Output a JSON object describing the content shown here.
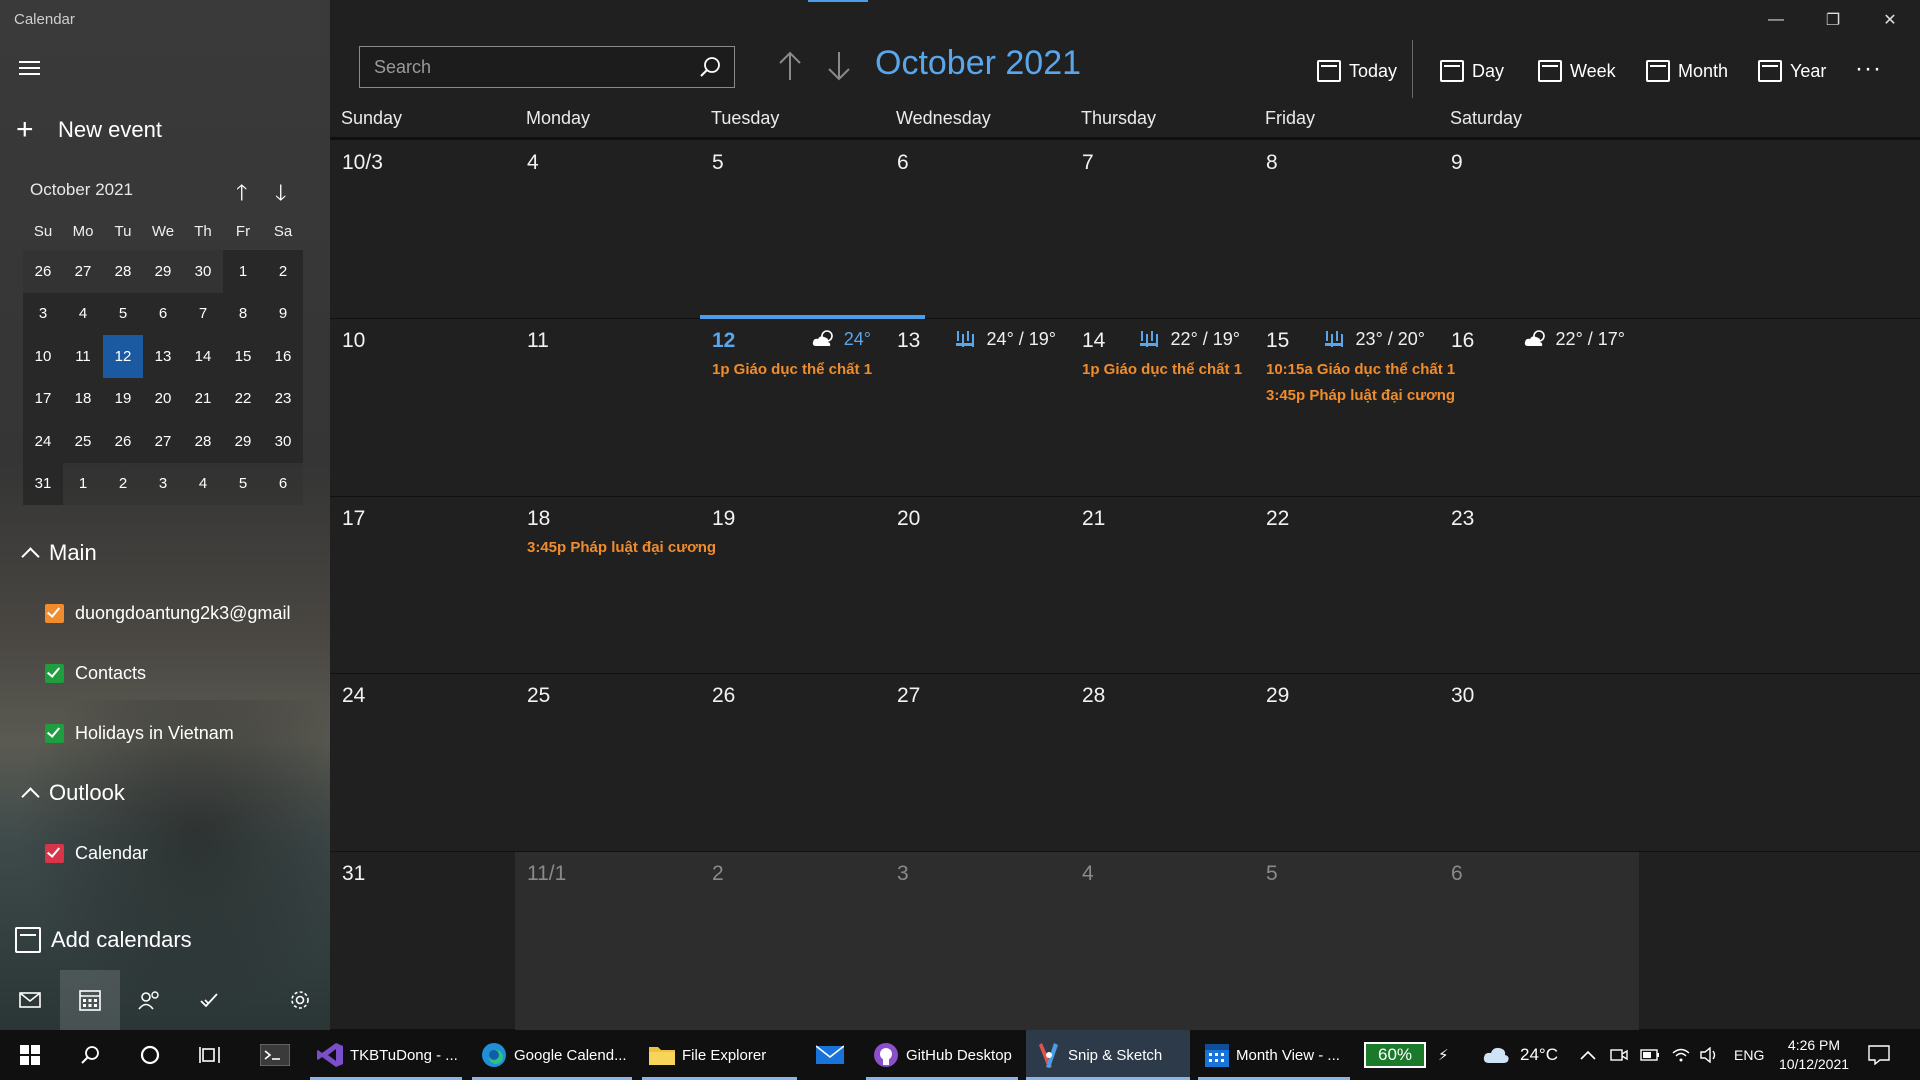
{
  "app": {
    "title": "Calendar"
  },
  "sidebar": {
    "new_event": "New event",
    "mini_month": "October 2021",
    "dow": [
      "Su",
      "Mo",
      "Tu",
      "We",
      "Th",
      "Fr",
      "Sa"
    ],
    "weeks": [
      [
        "26",
        "27",
        "28",
        "29",
        "30",
        "1",
        "2"
      ],
      [
        "3",
        "4",
        "5",
        "6",
        "7",
        "8",
        "9"
      ],
      [
        "10",
        "11",
        "12",
        "13",
        "14",
        "15",
        "16"
      ],
      [
        "17",
        "18",
        "19",
        "20",
        "21",
        "22",
        "23"
      ],
      [
        "24",
        "25",
        "26",
        "27",
        "28",
        "29",
        "30"
      ],
      [
        "31",
        "1",
        "2",
        "3",
        "4",
        "5",
        "6"
      ]
    ],
    "groups": [
      {
        "label": "Main",
        "items": [
          {
            "label": "duongdoantung2k3@gmail",
            "color": "#f08c2c"
          },
          {
            "label": "Contacts",
            "color": "#1f9e3f"
          },
          {
            "label": "Holidays in Vietnam",
            "color": "#1f9e3f"
          }
        ]
      },
      {
        "label": "Outlook",
        "items": [
          {
            "label": "Calendar",
            "color": "#d9344a"
          }
        ]
      }
    ],
    "add_calendars": "Add calendars"
  },
  "toolbar": {
    "search_placeholder": "Search",
    "month_title": "October 2021",
    "today": "Today",
    "day": "Day",
    "week": "Week",
    "month": "Month",
    "year": "Year",
    "more": "···"
  },
  "days_of_week": [
    "Sunday",
    "Monday",
    "Tuesday",
    "Wednesday",
    "Thursday",
    "Friday",
    "Saturday"
  ],
  "grid": [
    [
      {
        "n": "10/3"
      },
      {
        "n": "4"
      },
      {
        "n": "5"
      },
      {
        "n": "6"
      },
      {
        "n": "7"
      },
      {
        "n": "8"
      },
      {
        "n": "9"
      }
    ],
    [
      {
        "n": "10"
      },
      {
        "n": "11"
      },
      {
        "n": "12",
        "today": true,
        "weather": "24°",
        "wicon": "partly-cloudy",
        "events": [
          "1p Giáo dục thể chất 1"
        ]
      },
      {
        "n": "13",
        "weather": "24° / 19°",
        "wicon": "rain"
      },
      {
        "n": "14",
        "weather": "22° / 19°",
        "wicon": "rain",
        "events": [
          "1p Giáo dục thể chất 1"
        ]
      },
      {
        "n": "15",
        "weather": "23° / 20°",
        "wicon": "rain",
        "events": [
          "10:15a Giáo dục thể chất 1",
          "3:45p Pháp luật đại cương"
        ]
      },
      {
        "n": "16",
        "weather": "22° / 17°",
        "wicon": "partly-cloudy"
      }
    ],
    [
      {
        "n": "17"
      },
      {
        "n": "18",
        "events": [
          "3:45p Pháp luật đại cương"
        ]
      },
      {
        "n": "19"
      },
      {
        "n": "20"
      },
      {
        "n": "21"
      },
      {
        "n": "22"
      },
      {
        "n": "23"
      }
    ],
    [
      {
        "n": "24"
      },
      {
        "n": "25"
      },
      {
        "n": "26"
      },
      {
        "n": "27"
      },
      {
        "n": "28"
      },
      {
        "n": "29"
      },
      {
        "n": "30"
      }
    ],
    [
      {
        "n": "31"
      },
      {
        "n": "11/1",
        "other": true
      },
      {
        "n": "2",
        "other": true
      },
      {
        "n": "3",
        "other": true
      },
      {
        "n": "4",
        "other": true
      },
      {
        "n": "5",
        "other": true
      },
      {
        "n": "6",
        "other": true
      }
    ]
  ],
  "taskbar": {
    "apps": [
      {
        "label": "TKBTuDong - ...",
        "icon": "visual-studio-icon"
      },
      {
        "label": "Google Calend...",
        "icon": "edge-icon"
      },
      {
        "label": "File Explorer",
        "icon": "folder-icon"
      },
      {
        "label": "",
        "icon": "mail-icon"
      },
      {
        "label": "GitHub Desktop",
        "icon": "github-icon"
      },
      {
        "label": "Snip & Sketch",
        "icon": "snip-icon"
      },
      {
        "label": "Month View - ...",
        "icon": "calendar-icon"
      }
    ],
    "battery": "60%",
    "temperature": "24°C",
    "language": "ENG",
    "time": "4:26 PM",
    "date": "10/12/2021"
  }
}
